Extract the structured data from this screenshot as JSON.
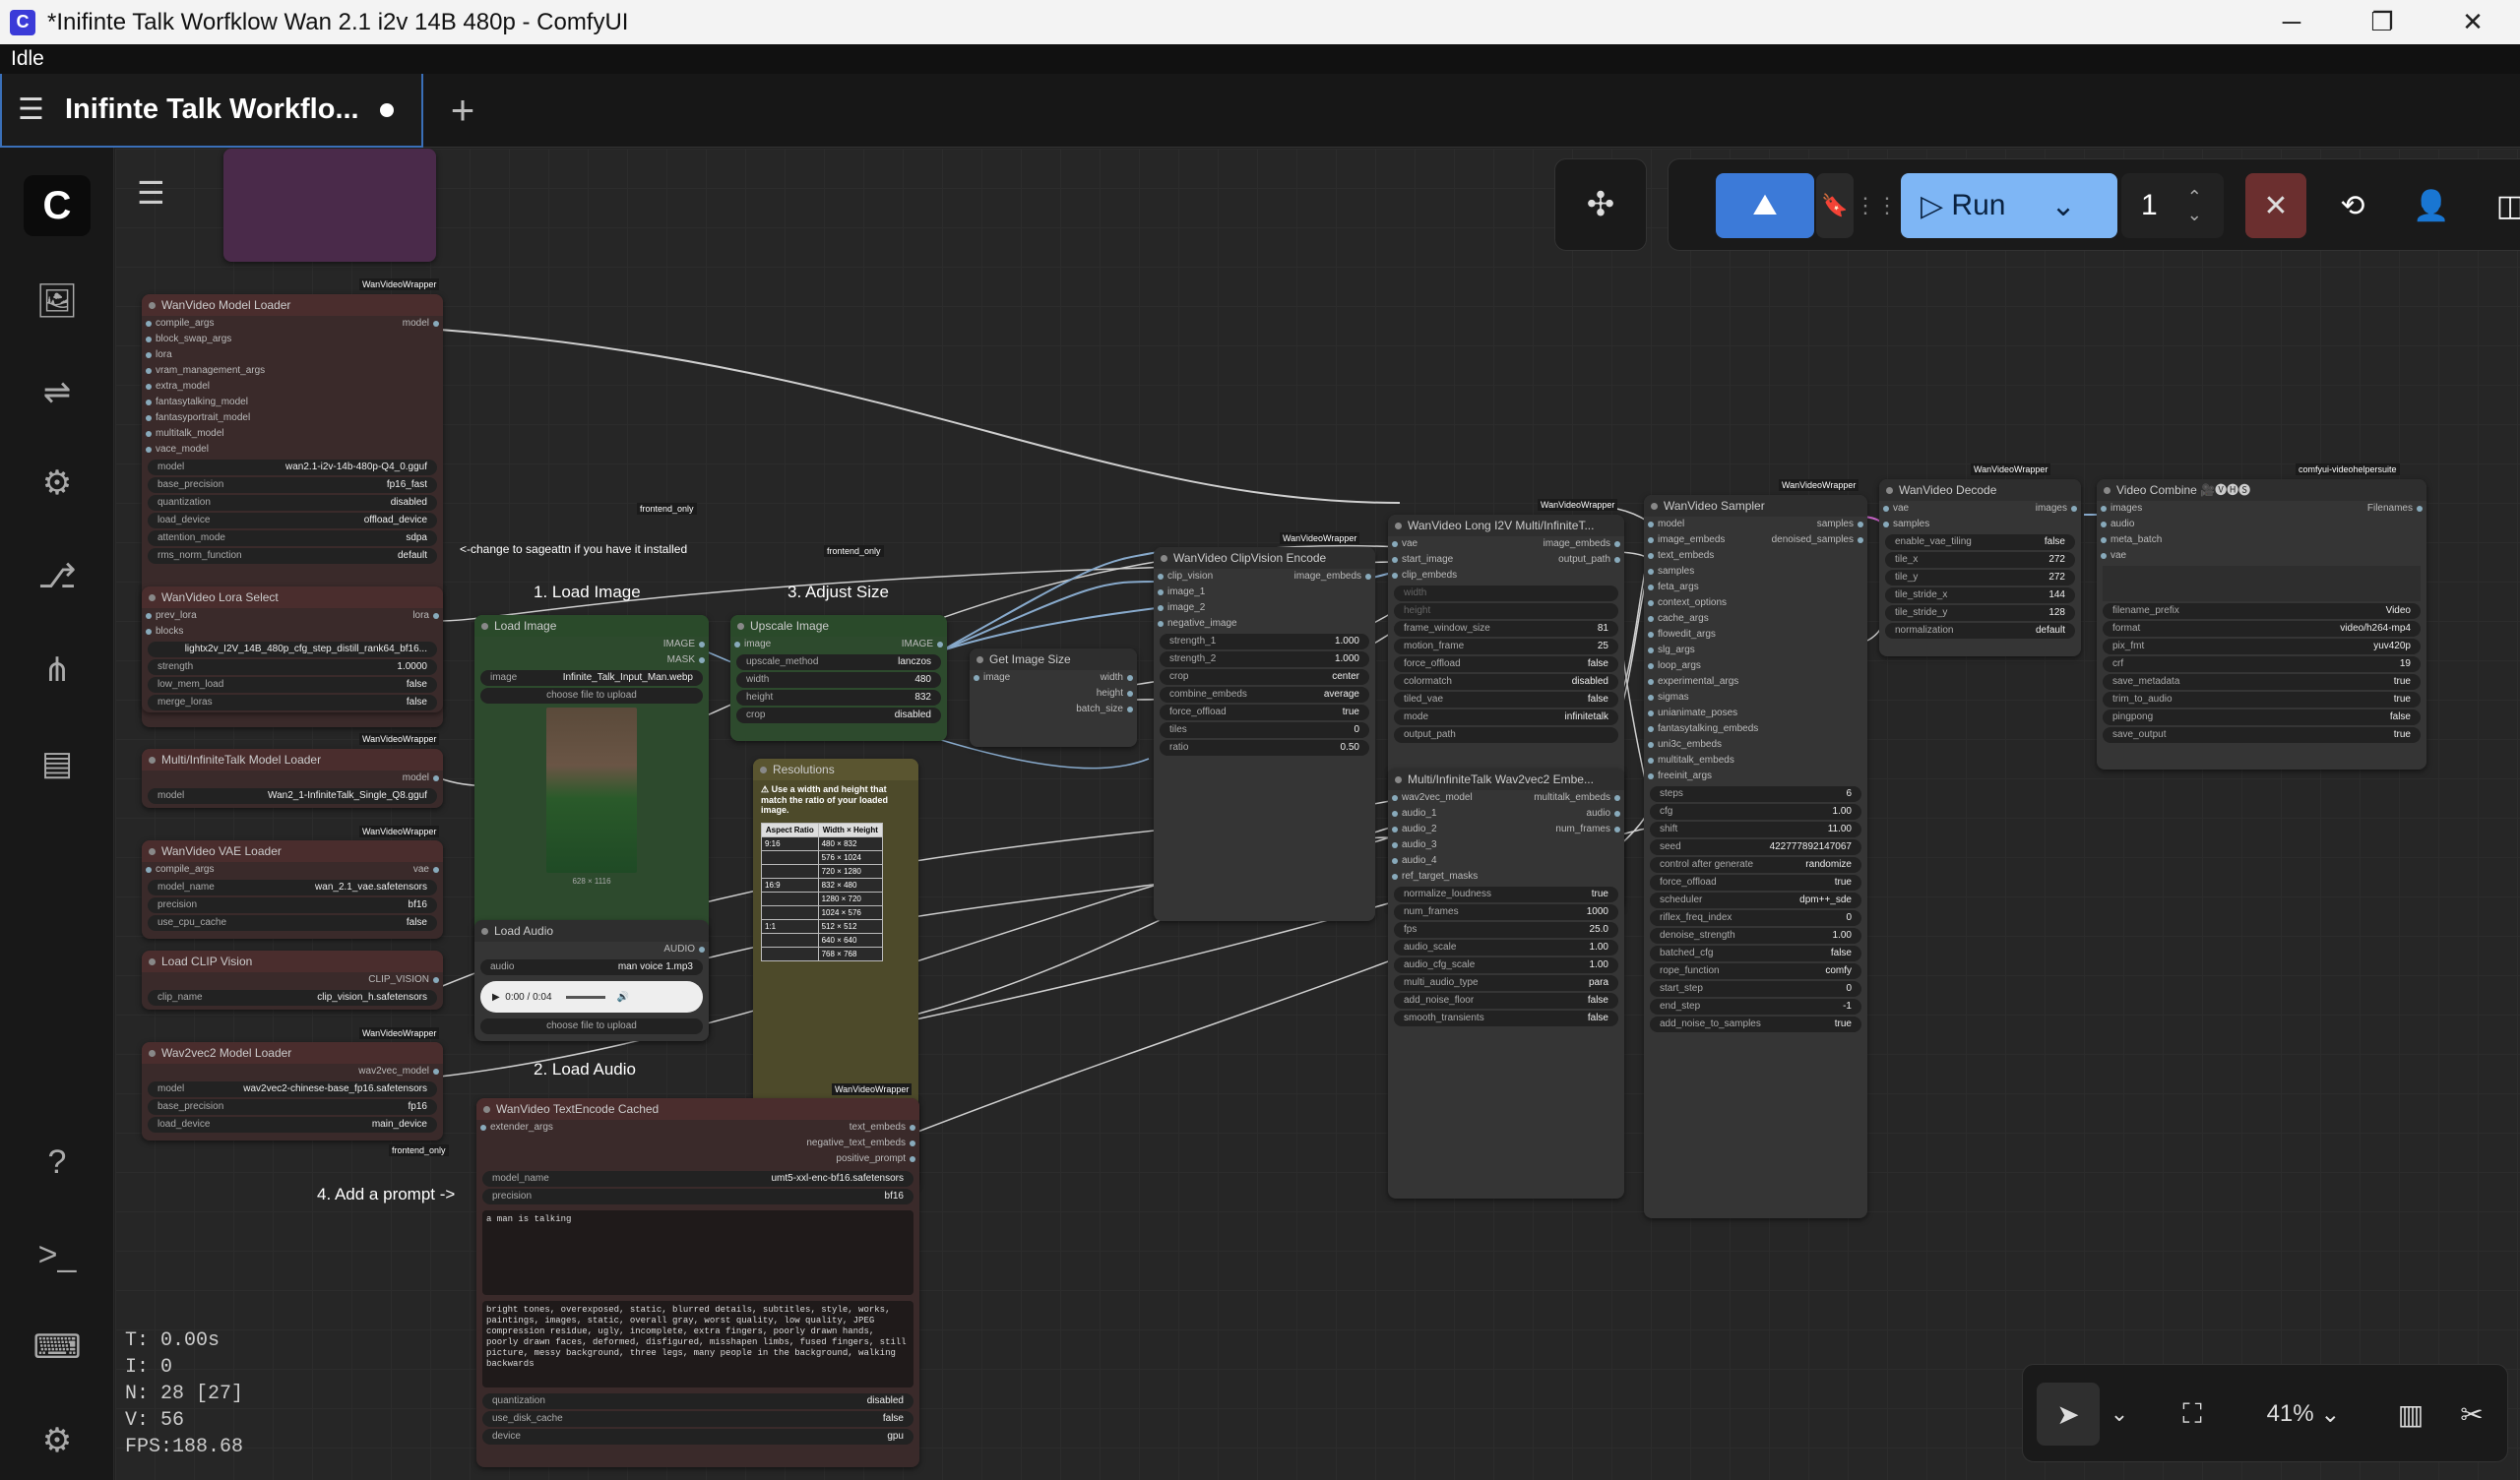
{
  "window": {
    "title": "*Inifinte Talk Worfklow Wan 2.1 i2v 14B 480p - ComfyUI",
    "app_icon": "C",
    "minimize": "─",
    "restore": "❐",
    "close": "✕"
  },
  "status": "Idle",
  "tab": {
    "name": "Inifinte Talk Workflo...",
    "add": "+"
  },
  "toolbar": {
    "run": "Run",
    "queue_count": "1"
  },
  "info": {
    "t": "T: 0.00s",
    "i": "I: 0",
    "n": "N: 28 [27]",
    "v": "V: 56",
    "fps": "FPS:188.68"
  },
  "zoom": "41%",
  "labels": {
    "change": "<-change to sageattn if you have it installed",
    "load_image": "1. Load Image",
    "adjust": "3. Adjust Size",
    "load_audio": "2. Load Audio",
    "prompt": "4. Add a prompt ->"
  },
  "tags": {
    "wvw": "WanVideoWrapper",
    "frontend": "frontend_only",
    "vhs": "comfyui-videohelpersuite"
  },
  "nodes": {
    "model_loader": {
      "title": "WanVideo Model Loader",
      "inputs": [
        "compile_args",
        "block_swap_args",
        "lora",
        "vram_management_args",
        "extra_model",
        "fantasytalking_model",
        "fantasyportrait_model",
        "multitalk_model",
        "vace_model"
      ],
      "output": "model",
      "widgets": [
        [
          "model",
          "wan2.1-i2v-14b-480p-Q4_0.gguf"
        ],
        [
          "base_precision",
          "fp16_fast"
        ],
        [
          "quantization",
          "disabled"
        ],
        [
          "load_device",
          "offload_device"
        ],
        [
          "attention_mode",
          "sdpa"
        ],
        [
          "rms_norm_function",
          "default"
        ]
      ]
    },
    "lora": {
      "title": "WanVideo Lora Select",
      "inputs": [
        "prev_lora",
        "blocks"
      ],
      "output": "lora",
      "widgets": [
        [
          "",
          "lightx2v_I2V_14B_480p_cfg_step_distill_rank64_bf16..."
        ],
        [
          "strength",
          "1.0000"
        ],
        [
          "low_mem_load",
          "false"
        ],
        [
          "merge_loras",
          "false"
        ]
      ]
    },
    "multi_model": {
      "title": "Multi/InfiniteTalk Model Loader",
      "output": "model",
      "widgets": [
        [
          "model",
          "Wan2_1-InfiniteTalk_Single_Q8.gguf"
        ]
      ]
    },
    "vae": {
      "title": "WanVideo VAE Loader",
      "inputs": [
        "compile_args"
      ],
      "output": "vae",
      "widgets": [
        [
          "model_name",
          "wan_2.1_vae.safetensors"
        ],
        [
          "precision",
          "bf16"
        ],
        [
          "use_cpu_cache",
          "false"
        ]
      ]
    },
    "clip": {
      "title": "Load CLIP Vision",
      "output": "CLIP_VISION",
      "widgets": [
        [
          "clip_name",
          "clip_vision_h.safetensors"
        ]
      ]
    },
    "wav2vec": {
      "title": "Wav2vec2 Model Loader",
      "output": "wav2vec_model",
      "widgets": [
        [
          "model",
          "wav2vec2-chinese-base_fp16.safetensors"
        ],
        [
          "base_precision",
          "fp16"
        ],
        [
          "load_device",
          "main_device"
        ]
      ]
    },
    "load_image": {
      "title": "Load Image",
      "outputs": [
        "IMAGE",
        "MASK"
      ],
      "image": "Infinite_Talk_Input_Man.webp",
      "button": "choose file to upload",
      "size": "628 × 1116"
    },
    "upscale": {
      "title": "Upscale Image",
      "input": "image",
      "output": "IMAGE",
      "widgets": [
        [
          "upscale_method",
          "lanczos"
        ],
        [
          "width",
          "480"
        ],
        [
          "height",
          "832"
        ],
        [
          "crop",
          "disabled"
        ]
      ]
    },
    "resolutions": {
      "title": "Resolutions",
      "note": "Use a width and height that match the ratio of your loaded image.",
      "head": [
        "Aspect Ratio",
        "Width × Height"
      ],
      "rows": [
        [
          "9:16",
          "480 × 832"
        ],
        [
          "",
          "576 × 1024"
        ],
        [
          "",
          "720 × 1280"
        ],
        [
          "16:9",
          "832 × 480"
        ],
        [
          "",
          "1280 × 720"
        ],
        [
          "",
          "1024 × 576"
        ],
        [
          "1:1",
          "512 × 512"
        ],
        [
          "",
          "640 × 640"
        ],
        [
          "",
          "768 × 768"
        ]
      ]
    },
    "load_audio": {
      "title": "Load Audio",
      "output": "AUDIO",
      "audio": "man voice 1.mp3",
      "time": "0:00 / 0:04",
      "button": "choose file to upload"
    },
    "textencode": {
      "title": "WanVideo TextEncode Cached",
      "input": "extender_args",
      "outputs": [
        "text_embeds",
        "negative_text_embeds",
        "positive_prompt"
      ],
      "widgets": [
        [
          "model_name",
          "umt5-xxl-enc-bf16.safetensors"
        ],
        [
          "precision",
          "bf16"
        ]
      ],
      "positive": "a man is talking",
      "negative": "bright tones, overexposed, static, blurred details, subtitles, style, works, paintings, images, static, overall gray, worst quality, low quality, JPEG compression residue, ugly, incomplete, extra fingers, poorly drawn hands, poorly drawn faces, deformed, disfigured, misshapen limbs, fused fingers, still picture, messy background, three legs, many people in the background, walking backwards",
      "widgets2": [
        [
          "quantization",
          "disabled"
        ],
        [
          "use_disk_cache",
          "false"
        ],
        [
          "device",
          "gpu"
        ]
      ]
    },
    "get_size": {
      "title": "Get Image Size",
      "input": "image",
      "outputs": [
        "width",
        "height",
        "batch_size"
      ]
    },
    "clipvision": {
      "title": "WanVideo ClipVision Encode",
      "inputs": [
        "clip_vision",
        "image_1",
        "image_2",
        "negative_image"
      ],
      "output": "image_embeds",
      "widgets": [
        [
          "strength_1",
          "1.000"
        ],
        [
          "strength_2",
          "1.000"
        ],
        [
          "crop",
          "center"
        ],
        [
          "combine_embeds",
          "average"
        ],
        [
          "force_offload",
          "true"
        ],
        [
          "tiles",
          "0"
        ],
        [
          "ratio",
          "0.50"
        ]
      ]
    },
    "long_i2v": {
      "title": "WanVideo Long I2V Multi/InfiniteT...",
      "inputs": [
        "vae",
        "start_image",
        "clip_embeds"
      ],
      "outputs": [
        "image_embeds",
        "output_path"
      ],
      "dim": [
        "width",
        "height"
      ],
      "widgets": [
        [
          "frame_window_size",
          "81"
        ],
        [
          "motion_frame",
          "25"
        ],
        [
          "force_offload",
          "false"
        ],
        [
          "colormatch",
          "disabled"
        ],
        [
          "tiled_vae",
          "false"
        ],
        [
          "mode",
          "infinitetalk"
        ],
        [
          "output_path",
          ""
        ]
      ]
    },
    "wav2vec_embed": {
      "title": "Multi/InfiniteTalk Wav2vec2 Embe...",
      "inputs": [
        "wav2vec_model",
        "audio_1",
        "audio_2",
        "audio_3",
        "audio_4",
        "ref_target_masks"
      ],
      "outputs": [
        "multitalk_embeds",
        "audio",
        "num_frames"
      ],
      "widgets": [
        [
          "normalize_loudness",
          "true"
        ],
        [
          "num_frames",
          "1000"
        ],
        [
          "fps",
          "25.0"
        ],
        [
          "audio_scale",
          "1.00"
        ],
        [
          "audio_cfg_scale",
          "1.00"
        ],
        [
          "multi_audio_type",
          "para"
        ],
        [
          "add_noise_floor",
          "false"
        ],
        [
          "smooth_transients",
          "false"
        ]
      ]
    },
    "sampler": {
      "title": "WanVideo Sampler",
      "inputs": [
        "model",
        "image_embeds",
        "text_embeds",
        "samples",
        "feta_args",
        "context_options",
        "cache_args",
        "flowedit_args",
        "slg_args",
        "loop_args",
        "experimental_args",
        "sigmas",
        "unianimate_poses",
        "fantasytalking_embeds",
        "uni3c_embeds",
        "multitalk_embeds",
        "freeinit_args"
      ],
      "outputs": [
        "samples",
        "denoised_samples"
      ],
      "widgets": [
        [
          "steps",
          "6"
        ],
        [
          "cfg",
          "1.00"
        ],
        [
          "shift",
          "11.00"
        ],
        [
          "seed",
          "422777892147067"
        ],
        [
          "control after generate",
          "randomize"
        ],
        [
          "force_offload",
          "true"
        ],
        [
          "scheduler",
          "dpm++_sde"
        ],
        [
          "riflex_freq_index",
          "0"
        ],
        [
          "denoise_strength",
          "1.00"
        ],
        [
          "batched_cfg",
          "false"
        ],
        [
          "rope_function",
          "comfy"
        ],
        [
          "start_step",
          "0"
        ],
        [
          "end_step",
          "-1"
        ],
        [
          "add_noise_to_samples",
          "true"
        ]
      ]
    },
    "decode": {
      "title": "WanVideo Decode",
      "inputs": [
        "vae",
        "samples"
      ],
      "output": "images",
      "widgets": [
        [
          "enable_vae_tiling",
          "false"
        ],
        [
          "tile_x",
          "272"
        ],
        [
          "tile_y",
          "272"
        ],
        [
          "tile_stride_x",
          "144"
        ],
        [
          "tile_stride_y",
          "128"
        ],
        [
          "normalization",
          "default"
        ]
      ]
    },
    "combine": {
      "title": "Video Combine 🎥🅥🅗🅢",
      "inputs": [
        "images",
        "audio",
        "meta_batch",
        "vae"
      ],
      "output": "Filenames",
      "widgets": [
        [
          "filename_prefix",
          "Video"
        ],
        [
          "format",
          "video/h264-mp4"
        ],
        [
          "pix_fmt",
          "yuv420p"
        ],
        [
          "crf",
          "19"
        ],
        [
          "save_metadata",
          "true"
        ],
        [
          "trim_to_audio",
          "true"
        ],
        [
          "pingpong",
          "false"
        ],
        [
          "save_output",
          "true"
        ]
      ]
    }
  }
}
